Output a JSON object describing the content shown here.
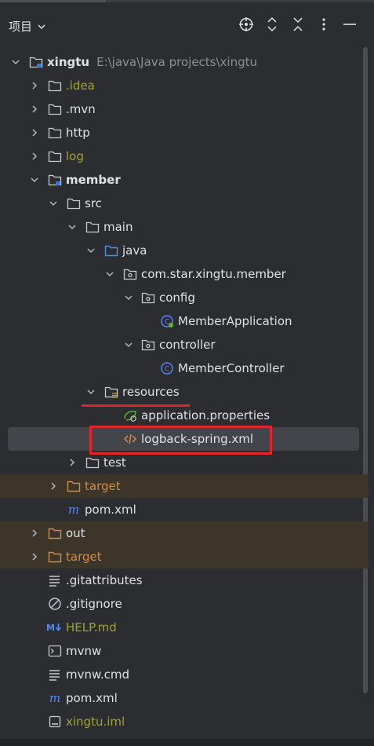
{
  "header": {
    "title": "项目",
    "tools": [
      "target-icon",
      "expand-icon",
      "collapse-icon",
      "more-icon",
      "minimize-icon"
    ]
  },
  "root": {
    "name": "xingtu",
    "path": "E:\\java\\Java projects\\xingtu"
  },
  "items": {
    "idea": ".idea",
    "mvn": ".mvn",
    "http": "http",
    "log": "log",
    "member": "member",
    "src": "src",
    "main": "main",
    "java": "java",
    "pkg": "com.star.xingtu.member",
    "config": "config",
    "member_app": "MemberApplication",
    "controller": "controller",
    "member_ctrl": "MemberController",
    "resources": "resources",
    "app_props": "application.properties",
    "logback": "logback-spring.xml",
    "test": "test",
    "member_target": "target",
    "member_pom": "pom.xml",
    "out": "out",
    "target": "target",
    "gitattributes": ".gitattributes",
    "gitignore": ".gitignore",
    "help": "HELP.md",
    "mvnw": "mvnw",
    "mvnw_cmd": "mvnw.cmd",
    "pom": "pom.xml",
    "iml": "xingtu.iml"
  },
  "colors": {
    "background": "#2b2d30",
    "selected": "#43454a",
    "excluded_row": "#3d342a",
    "annotation_red": "#e0262a",
    "ignored_text": "#a0a33b",
    "excluded_text": "#cb8e4d"
  }
}
